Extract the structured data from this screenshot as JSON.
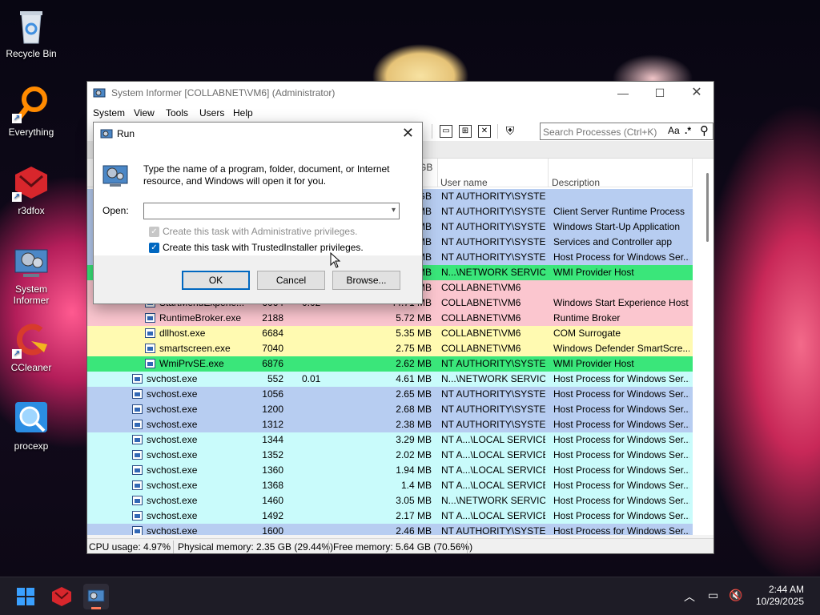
{
  "desktop": {
    "icons": [
      {
        "label": "Recycle Bin"
      },
      {
        "label": "Everything"
      },
      {
        "label": "r3dfox"
      },
      {
        "label": "System Informer",
        "line1": "System",
        "line2": "Informer"
      },
      {
        "label": "CCleaner"
      },
      {
        "label": "procexp"
      }
    ]
  },
  "window": {
    "title": "System Informer [COLLABNET\\VM6] (Administrator)",
    "menu": [
      "System",
      "View",
      "Tools",
      "Users",
      "Help"
    ],
    "search_placeholder": "Search Processes (Ctrl+K)",
    "search_buttons": [
      "Aa",
      ".*"
    ],
    "partial_header": "GB",
    "columns": [
      "User name",
      "Description"
    ],
    "rows": [
      {
        "name": "",
        "pid": "",
        "cpu": "",
        "mem": "GB",
        "user": "NT AUTHORITY\\SYSTEM",
        "desc": "",
        "bg": "#b7cdf1",
        "indent": 0
      },
      {
        "name": "",
        "pid": "",
        "cpu": "",
        "mem": "MB",
        "user": "NT AUTHORITY\\SYSTEM",
        "desc": "Client Server Runtime Process",
        "bg": "#b7cdf1",
        "indent": 0
      },
      {
        "name": "",
        "pid": "",
        "cpu": "",
        "mem": "MB",
        "user": "NT AUTHORITY\\SYSTEM",
        "desc": "Windows Start-Up Application",
        "bg": "#b7cdf1",
        "indent": 0
      },
      {
        "name": "",
        "pid": "",
        "cpu": "",
        "mem": "MB",
        "user": "NT AUTHORITY\\SYSTEM",
        "desc": "Services and Controller app",
        "bg": "#b7cdf1",
        "indent": 0
      },
      {
        "name": "",
        "pid": "",
        "cpu": "",
        "mem": "MB",
        "user": "NT AUTHORITY\\SYSTEM",
        "desc": "Host Process for Windows Ser...",
        "bg": "#b7cdf1",
        "indent": 0
      },
      {
        "name": "",
        "pid": "",
        "cpu": "",
        "mem": "MB",
        "user": "N...\\NETWORK SERVICE",
        "desc": "WMI Provider Host",
        "bg": "#3ae67a",
        "indent": 0
      },
      {
        "name": "",
        "pid": "",
        "cpu": "",
        "mem": "MB",
        "user": "COLLABNET\\VM6",
        "desc": "",
        "bg": "#fbc6cf",
        "indent": 0
      },
      {
        "name": "StartMenuExperie...",
        "pid": "6064",
        "cpu": "0.02",
        "mem": "44.71 MB",
        "user": "COLLABNET\\VM6",
        "desc": "Windows Start Experience Host",
        "bg": "#fbc6cf",
        "indent": 1
      },
      {
        "name": "RuntimeBroker.exe",
        "pid": "2188",
        "cpu": "",
        "mem": "5.72 MB",
        "user": "COLLABNET\\VM6",
        "desc": "Runtime Broker",
        "bg": "#fbc6cf",
        "indent": 1
      },
      {
        "name": "dllhost.exe",
        "pid": "6684",
        "cpu": "",
        "mem": "5.35 MB",
        "user": "COLLABNET\\VM6",
        "desc": "COM Surrogate",
        "bg": "#fffab1",
        "indent": 1
      },
      {
        "name": "smartscreen.exe",
        "pid": "7040",
        "cpu": "",
        "mem": "2.75 MB",
        "user": "COLLABNET\\VM6",
        "desc": "Windows Defender SmartScre...",
        "bg": "#fffab1",
        "indent": 1
      },
      {
        "name": "WmiPrvSE.exe",
        "pid": "6876",
        "cpu": "",
        "mem": "2.62 MB",
        "user": "NT AUTHORITY\\SYSTEM",
        "desc": "WMI Provider Host",
        "bg": "#3ae67a",
        "indent": 1
      },
      {
        "name": "svchost.exe",
        "pid": "552",
        "cpu": "0.01",
        "mem": "4.61 MB",
        "user": "N...\\NETWORK SERVICE",
        "desc": "Host Process for Windows Ser...",
        "bg": "#c9fbfb",
        "indent": 0
      },
      {
        "name": "svchost.exe",
        "pid": "1056",
        "cpu": "",
        "mem": "2.65 MB",
        "user": "NT AUTHORITY\\SYSTEM",
        "desc": "Host Process for Windows Ser...",
        "bg": "#b7cdf1",
        "indent": 0
      },
      {
        "name": "svchost.exe",
        "pid": "1200",
        "cpu": "",
        "mem": "2.68 MB",
        "user": "NT AUTHORITY\\SYSTEM",
        "desc": "Host Process for Windows Ser...",
        "bg": "#b7cdf1",
        "indent": 0
      },
      {
        "name": "svchost.exe",
        "pid": "1312",
        "cpu": "",
        "mem": "2.38 MB",
        "user": "NT AUTHORITY\\SYSTEM",
        "desc": "Host Process for Windows Ser...",
        "bg": "#b7cdf1",
        "indent": 0
      },
      {
        "name": "svchost.exe",
        "pid": "1344",
        "cpu": "",
        "mem": "3.29 MB",
        "user": "NT A...\\LOCAL SERVICE",
        "desc": "Host Process for Windows Ser...",
        "bg": "#c9fbfb",
        "indent": 0
      },
      {
        "name": "svchost.exe",
        "pid": "1352",
        "cpu": "",
        "mem": "2.02 MB",
        "user": "NT A...\\LOCAL SERVICE",
        "desc": "Host Process for Windows Ser...",
        "bg": "#c9fbfb",
        "indent": 0
      },
      {
        "name": "svchost.exe",
        "pid": "1360",
        "cpu": "",
        "mem": "1.94 MB",
        "user": "NT A...\\LOCAL SERVICE",
        "desc": "Host Process for Windows Ser...",
        "bg": "#c9fbfb",
        "indent": 0
      },
      {
        "name": "svchost.exe",
        "pid": "1368",
        "cpu": "",
        "mem": "1.4 MB",
        "user": "NT A...\\LOCAL SERVICE",
        "desc": "Host Process for Windows Ser...",
        "bg": "#c9fbfb",
        "indent": 0
      },
      {
        "name": "svchost.exe",
        "pid": "1460",
        "cpu": "",
        "mem": "3.05 MB",
        "user": "N...\\NETWORK SERVICE",
        "desc": "Host Process for Windows Ser...",
        "bg": "#c9fbfb",
        "indent": 0
      },
      {
        "name": "svchost.exe",
        "pid": "1492",
        "cpu": "",
        "mem": "2.17 MB",
        "user": "NT A...\\LOCAL SERVICE",
        "desc": "Host Process for Windows Ser...",
        "bg": "#c9fbfb",
        "indent": 0
      },
      {
        "name": "svchost.exe",
        "pid": "1600",
        "cpu": "",
        "mem": "2.46 MB",
        "user": "NT AUTHORITY\\SYSTEM",
        "desc": "Host Process for Windows Ser...",
        "bg": "#b7cdf1",
        "indent": 0
      }
    ],
    "status": {
      "cpu": "CPU usage: 4.97%",
      "physical": "Physical memory: 2.35 GB (29.44%)",
      "free": "Free memory: 5.64 GB (70.56%)"
    }
  },
  "run_dialog": {
    "title": "Run",
    "description": "Type the name of a program, folder, document, or Internet resource, and Windows will open it for you.",
    "open_label": "Open:",
    "open_value": "",
    "check_admin": {
      "label": "Create this task with Administrative privileges.",
      "checked": true,
      "disabled": true
    },
    "check_trusted": {
      "label": "Create this task with TrustedInstaller privileges.",
      "checked": true,
      "disabled": false
    },
    "ok": "OK",
    "cancel": "Cancel",
    "browse": "Browse..."
  },
  "taskbar": {
    "time": "2:44 AM",
    "date": "10/29/2025"
  },
  "colors": {
    "accent": "#0067c0",
    "service_row": "#c9fbfb",
    "system_row": "#b7cdf1",
    "own_process_row": "#fbc6cf",
    "wmi_row": "#3ae67a",
    "dotnet_row": "#fffab1"
  }
}
